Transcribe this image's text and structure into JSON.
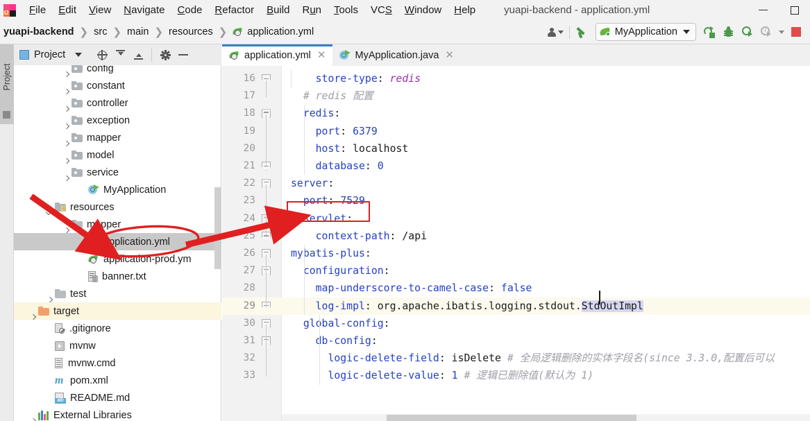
{
  "window": {
    "title": "yuapi-backend - application.yml",
    "minimize_label": "—",
    "maximize_label": "□"
  },
  "menubar": {
    "logo": "intellij-idea-logo",
    "items": [
      {
        "label": "File",
        "mnemonic": "F"
      },
      {
        "label": "Edit",
        "mnemonic": "E"
      },
      {
        "label": "View",
        "mnemonic": "V"
      },
      {
        "label": "Navigate",
        "mnemonic": "N"
      },
      {
        "label": "Code",
        "mnemonic": "C"
      },
      {
        "label": "Refactor",
        "mnemonic": "R"
      },
      {
        "label": "Build",
        "mnemonic": "B"
      },
      {
        "label": "Run",
        "mnemonic": "R"
      },
      {
        "label": "Tools",
        "mnemonic": "T"
      },
      {
        "label": "VCS",
        "mnemonic": "S"
      },
      {
        "label": "Window",
        "mnemonic": "W"
      },
      {
        "label": "Help",
        "mnemonic": "H"
      }
    ]
  },
  "navbar": {
    "breadcrumbs": [
      {
        "label": "yuapi-backend",
        "icon": null
      },
      {
        "label": "src",
        "icon": null
      },
      {
        "label": "main",
        "icon": null
      },
      {
        "label": "resources",
        "icon": null
      },
      {
        "label": "application.yml",
        "icon": "yaml-file-icon"
      }
    ],
    "separator": "❯",
    "run_config": {
      "label": "MyApplication",
      "icon": "spring-boot-icon"
    },
    "actions": [
      {
        "name": "user-settings-icon",
        "label": ""
      },
      {
        "name": "build-hammer-icon",
        "label": ""
      },
      {
        "name": "run-icon",
        "label": ""
      },
      {
        "name": "debug-icon",
        "label": ""
      },
      {
        "name": "run-with-coverage-icon",
        "label": ""
      },
      {
        "name": "profiler-icon",
        "label": ""
      },
      {
        "name": "stop-icon",
        "label": ""
      }
    ]
  },
  "toolstrip": {
    "project_tab": "Project"
  },
  "project_panel": {
    "title": "Project",
    "toolbar": [
      {
        "name": "select-opened-file-icon"
      },
      {
        "name": "expand-all-icon"
      },
      {
        "name": "collapse-all-icon"
      },
      {
        "name": "settings-gear-icon"
      },
      {
        "name": "hide-panel-icon"
      }
    ],
    "tree": [
      {
        "label": "config",
        "indent": 2,
        "chev": "r",
        "icon": "folder-package",
        "state": "partial-top"
      },
      {
        "label": "constant",
        "indent": 2,
        "chev": "r",
        "icon": "folder-package",
        "state": ""
      },
      {
        "label": "controller",
        "indent": 2,
        "chev": "r",
        "icon": "folder-package",
        "state": ""
      },
      {
        "label": "exception",
        "indent": 2,
        "chev": "r",
        "icon": "folder-package",
        "state": ""
      },
      {
        "label": "mapper",
        "indent": 2,
        "chev": "r",
        "icon": "folder-package",
        "state": ""
      },
      {
        "label": "model",
        "indent": 2,
        "chev": "r",
        "icon": "folder-package",
        "state": ""
      },
      {
        "label": "service",
        "indent": 2,
        "chev": "r",
        "icon": "folder-package",
        "state": ""
      },
      {
        "label": "MyApplication",
        "indent": 3,
        "chev": "",
        "icon": "spring-class",
        "state": ""
      },
      {
        "label": "resources",
        "indent": 1,
        "chev": "d",
        "icon": "folder-resources",
        "state": ""
      },
      {
        "label": "mapper",
        "indent": 2,
        "chev": "r",
        "icon": "folder-plain",
        "state": ""
      },
      {
        "label": "application.yml",
        "indent": 3,
        "chev": "",
        "icon": "yaml-file",
        "state": "selected"
      },
      {
        "label": "application-prod.ym",
        "indent": 3,
        "chev": "",
        "icon": "yaml-file",
        "state": ""
      },
      {
        "label": "banner.txt",
        "indent": 3,
        "chev": "",
        "icon": "text-file",
        "state": ""
      },
      {
        "label": "test",
        "indent": 1,
        "chev": "r",
        "icon": "folder-plain",
        "state": ""
      },
      {
        "label": "target",
        "indent": 0,
        "chev": "r",
        "icon": "folder-target",
        "state": "highlight"
      },
      {
        "label": ".gitignore",
        "indent": 1,
        "chev": "",
        "icon": "gitignore-file",
        "state": ""
      },
      {
        "label": "mvnw",
        "indent": 1,
        "chev": "",
        "icon": "mvnw-file",
        "state": ""
      },
      {
        "label": "mvnw.cmd",
        "indent": 1,
        "chev": "",
        "icon": "cmd-file",
        "state": ""
      },
      {
        "label": "pom.xml",
        "indent": 1,
        "chev": "",
        "icon": "maven-file",
        "state": ""
      },
      {
        "label": "README.md",
        "indent": 1,
        "chev": "",
        "icon": "markdown-file",
        "state": ""
      },
      {
        "label": "External Libraries",
        "indent": 0,
        "chev": "r",
        "icon": "libraries",
        "state": ""
      }
    ]
  },
  "editor": {
    "tabs": [
      {
        "label": "application.yml",
        "icon": "yaml-file-icon",
        "active": true,
        "close": "✕"
      },
      {
        "label": "MyApplication.java",
        "icon": "spring-class-icon",
        "active": false,
        "close": "✕"
      }
    ],
    "first_line": 16,
    "current_line": 29,
    "caret_word": "StdOutImpl",
    "lines": [
      {
        "n": "16",
        "indent": 4,
        "fold": "open",
        "text": "store-type: redis"
      },
      {
        "n": "17",
        "indent": 2,
        "fold": "",
        "text": "# redis 配置"
      },
      {
        "n": "18",
        "indent": 2,
        "fold": "mid",
        "text": "redis:"
      },
      {
        "n": "19",
        "indent": 4,
        "fold": "",
        "text": "port: 6379"
      },
      {
        "n": "20",
        "indent": 4,
        "fold": "",
        "text": "host: localhost"
      },
      {
        "n": "21",
        "indent": 4,
        "fold": "open",
        "text": "database: 0"
      },
      {
        "n": "22",
        "indent": 0,
        "fold": "mid",
        "text": "server:"
      },
      {
        "n": "23",
        "indent": 2,
        "fold": "",
        "text": "port: 7529"
      },
      {
        "n": "24",
        "indent": 2,
        "fold": "mid",
        "text": "servlet:"
      },
      {
        "n": "25",
        "indent": 4,
        "fold": "open",
        "text": "context-path: /api"
      },
      {
        "n": "26",
        "indent": 0,
        "fold": "mid",
        "text": "mybatis-plus:"
      },
      {
        "n": "27",
        "indent": 2,
        "fold": "mid",
        "text": "configuration:"
      },
      {
        "n": "28",
        "indent": 4,
        "fold": "",
        "text": "map-underscore-to-camel-case: false"
      },
      {
        "n": "29",
        "indent": 4,
        "fold": "open",
        "text": "log-impl: org.apache.ibatis.logging.stdout.StdOutImpl"
      },
      {
        "n": "30",
        "indent": 2,
        "fold": "mid",
        "text": "global-config:"
      },
      {
        "n": "31",
        "indent": 4,
        "fold": "mid",
        "text": "db-config:"
      },
      {
        "n": "32",
        "indent": 6,
        "fold": "",
        "text": "logic-delete-field: isDelete # 全局逻辑删除的实体字段名(since 3.3.0,配置后可以"
      },
      {
        "n": "33",
        "indent": 6,
        "fold": "",
        "text": "logic-delete-value: 1 # 逻辑已删除值(默认为 1)"
      }
    ]
  },
  "annotations": {
    "highlight_box_target": "port: 7529",
    "ellipse_target": "application.yml",
    "arrow1": "points-to-application-yml-in-tree",
    "arrow2": "points-to-port-7529-in-editor",
    "color": "#e02020"
  }
}
